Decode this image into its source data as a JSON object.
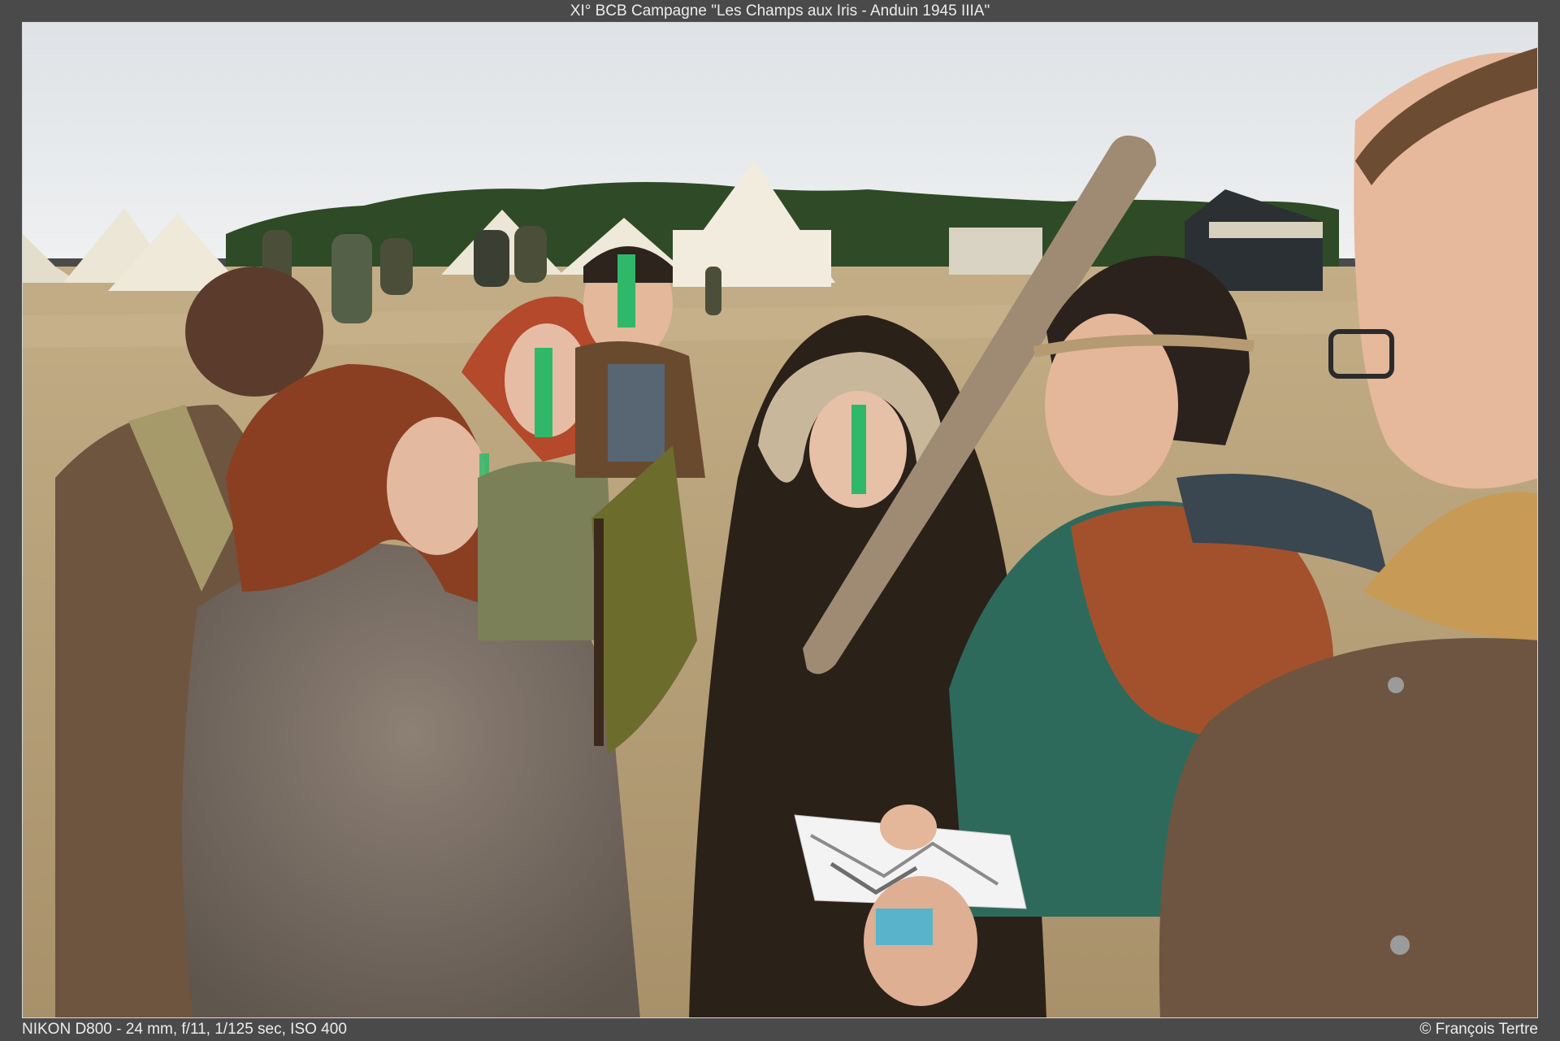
{
  "title": "XI° BCB Campagne \"Les Champs aux Iris - Anduin 1945 IIIA\"",
  "exif": "NIKON D800 - 24 mm, f/11, 1/125 sec, ISO 400",
  "credit": "© François Tertre",
  "colors": {
    "frame": "#4a4a4a",
    "sky": "#e6e8ea",
    "treeline": "#2f4a26",
    "field": "#b9a27a",
    "tent": "#ece6d6",
    "face_paint": "#2fb86a"
  }
}
